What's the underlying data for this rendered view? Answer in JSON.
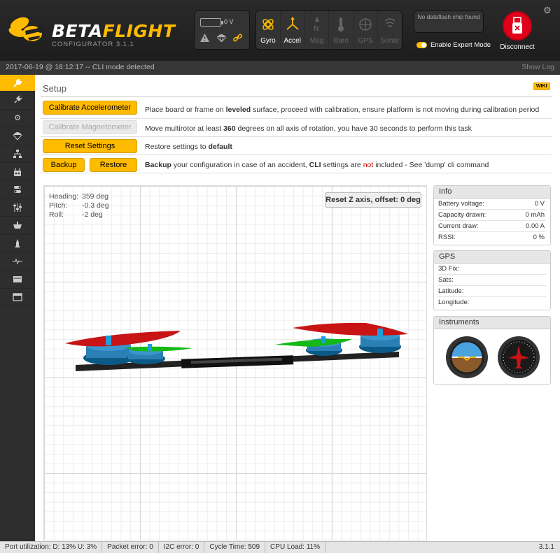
{
  "app": {
    "name_part1": "BETA",
    "name_part2": "FLIGHT",
    "subtitle": "CONFIGURATOR  3.1.1"
  },
  "header": {
    "battery_voltage": "0 V",
    "sensors": [
      {
        "label": "Gyro",
        "active": true
      },
      {
        "label": "Accel",
        "active": true
      },
      {
        "label": "Mag",
        "active": false
      },
      {
        "label": "Baro",
        "active": false
      },
      {
        "label": "GPS",
        "active": false
      },
      {
        "label": "Sonar",
        "active": false
      }
    ],
    "dataflash_text": "No dataflash chip found",
    "expert_mode_label": "Enable Expert Mode",
    "expert_mode_on": true,
    "disconnect_label": "Disconnect"
  },
  "status": {
    "log_line": "2017-06-19 @ 18:12:17 -- CLI mode detected",
    "show_log": "Show Log"
  },
  "setup": {
    "title": "Setup",
    "wiki": "WIKI",
    "calibrate_acc_label": "Calibrate Accelerometer",
    "calibrate_acc_text": [
      "Place board or frame on ",
      "leveled",
      " surface, proceed with calibration, ensure platform is not moving during calibration period"
    ],
    "calibrate_mag_label": "Calibrate Magnetometer",
    "calibrate_mag_text": [
      "Move multirotor at least ",
      "360",
      " degrees on all axis of rotation, you have 30 seconds to perform this task"
    ],
    "reset_label": "Reset Settings",
    "reset_text": [
      "Restore settings to ",
      "default"
    ],
    "backup_label": "Backup",
    "restore_label": "Restore",
    "backup_text": [
      "Backup",
      " your configuration in case of an accident, ",
      "CLI",
      " settings are ",
      "not",
      " included - See 'dump' cli command"
    ]
  },
  "attitude": {
    "heading_label": "Heading:",
    "heading_value": "359 deg",
    "pitch_label": "Pitch:",
    "pitch_value": "-0.3 deg",
    "roll_label": "Roll:",
    "roll_value": "-2 deg",
    "reset_z_label": "Reset Z axis, offset: 0 deg"
  },
  "info": {
    "title": "Info",
    "rows": [
      {
        "label": "Battery voltage:",
        "value": "0 V"
      },
      {
        "label": "Capacity drawn:",
        "value": "0 mAh"
      },
      {
        "label": "Current draw:",
        "value": "0.00 A"
      },
      {
        "label": "RSSI:",
        "value": "0 %"
      }
    ]
  },
  "gps": {
    "title": "GPS",
    "rows": [
      {
        "label": "3D Fix:",
        "value": ""
      },
      {
        "label": "Sats:",
        "value": ""
      },
      {
        "label": "Latitude:",
        "value": ""
      },
      {
        "label": "Longitude:",
        "value": ""
      }
    ]
  },
  "instruments": {
    "title": "Instruments"
  },
  "footer": {
    "port_util": "Port utilization: D: 13% U: 3%",
    "packet_error": "Packet error: 0",
    "i2c_error": "I2C error: 0",
    "cycle_time": "Cycle Time: 509",
    "cpu_load": "CPU Load: 11%",
    "version": "3.1.1"
  },
  "colors": {
    "accent": "#ffbb00",
    "disconnect": "#e0001a",
    "warning_text": "#cc0000"
  },
  "sidebar": {
    "items": [
      {
        "icon": "wrench-icon",
        "active": true
      },
      {
        "icon": "plug-icon",
        "active": false
      },
      {
        "icon": "gear-icon",
        "active": false
      },
      {
        "icon": "parachute-icon",
        "active": false
      },
      {
        "icon": "network-icon",
        "active": false
      },
      {
        "icon": "receiver-icon",
        "active": false
      },
      {
        "icon": "modes-icon",
        "active": false
      },
      {
        "icon": "sliders-icon",
        "active": false
      },
      {
        "icon": "motor-icon",
        "active": false
      },
      {
        "icon": "led-icon",
        "active": false
      },
      {
        "icon": "sensors-icon",
        "active": false
      },
      {
        "icon": "blackbox-icon",
        "active": false
      },
      {
        "icon": "cli-icon",
        "active": false
      }
    ]
  }
}
